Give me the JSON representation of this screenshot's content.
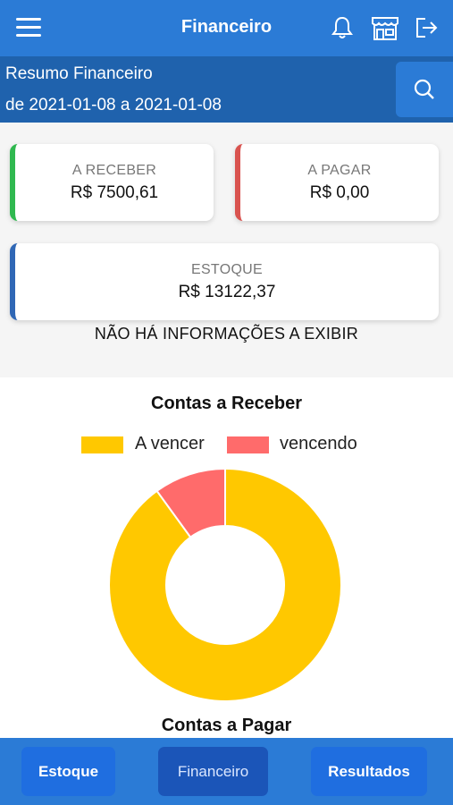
{
  "header": {
    "title": "Financeiro"
  },
  "summary": {
    "title": "Resumo Financeiro",
    "period": "de 2021-01-08 a 2021-01-08"
  },
  "cards": {
    "receber": {
      "label": "A RECEBER",
      "value": "R$ 7500,61",
      "color": "#2fb84f"
    },
    "pagar": {
      "label": "A PAGAR",
      "value": "R$ 0,00",
      "color": "#d9534f"
    },
    "estoque": {
      "label": "ESTOQUE",
      "value": "R$ 13122,37",
      "color": "#2f67b5"
    }
  },
  "no_info": "NÃO HÁ INFORMAÇÕES A EXIBIR",
  "chart_data": {
    "type": "pie",
    "title": "Contas a Receber",
    "categories": [
      "A vencer",
      "vencendo"
    ],
    "values": [
      90,
      10
    ],
    "colors": [
      "#ffc800",
      "#ff6b6b"
    ],
    "legend": "top"
  },
  "next_section_title": "Contas a Pagar",
  "tabs": [
    {
      "label": "Estoque",
      "active": false
    },
    {
      "label": "Financeiro",
      "active": true
    },
    {
      "label": "Resultados",
      "active": false
    }
  ],
  "colors": {
    "primary": "#2b7bd6",
    "primary_dark": "#1f62ad"
  }
}
